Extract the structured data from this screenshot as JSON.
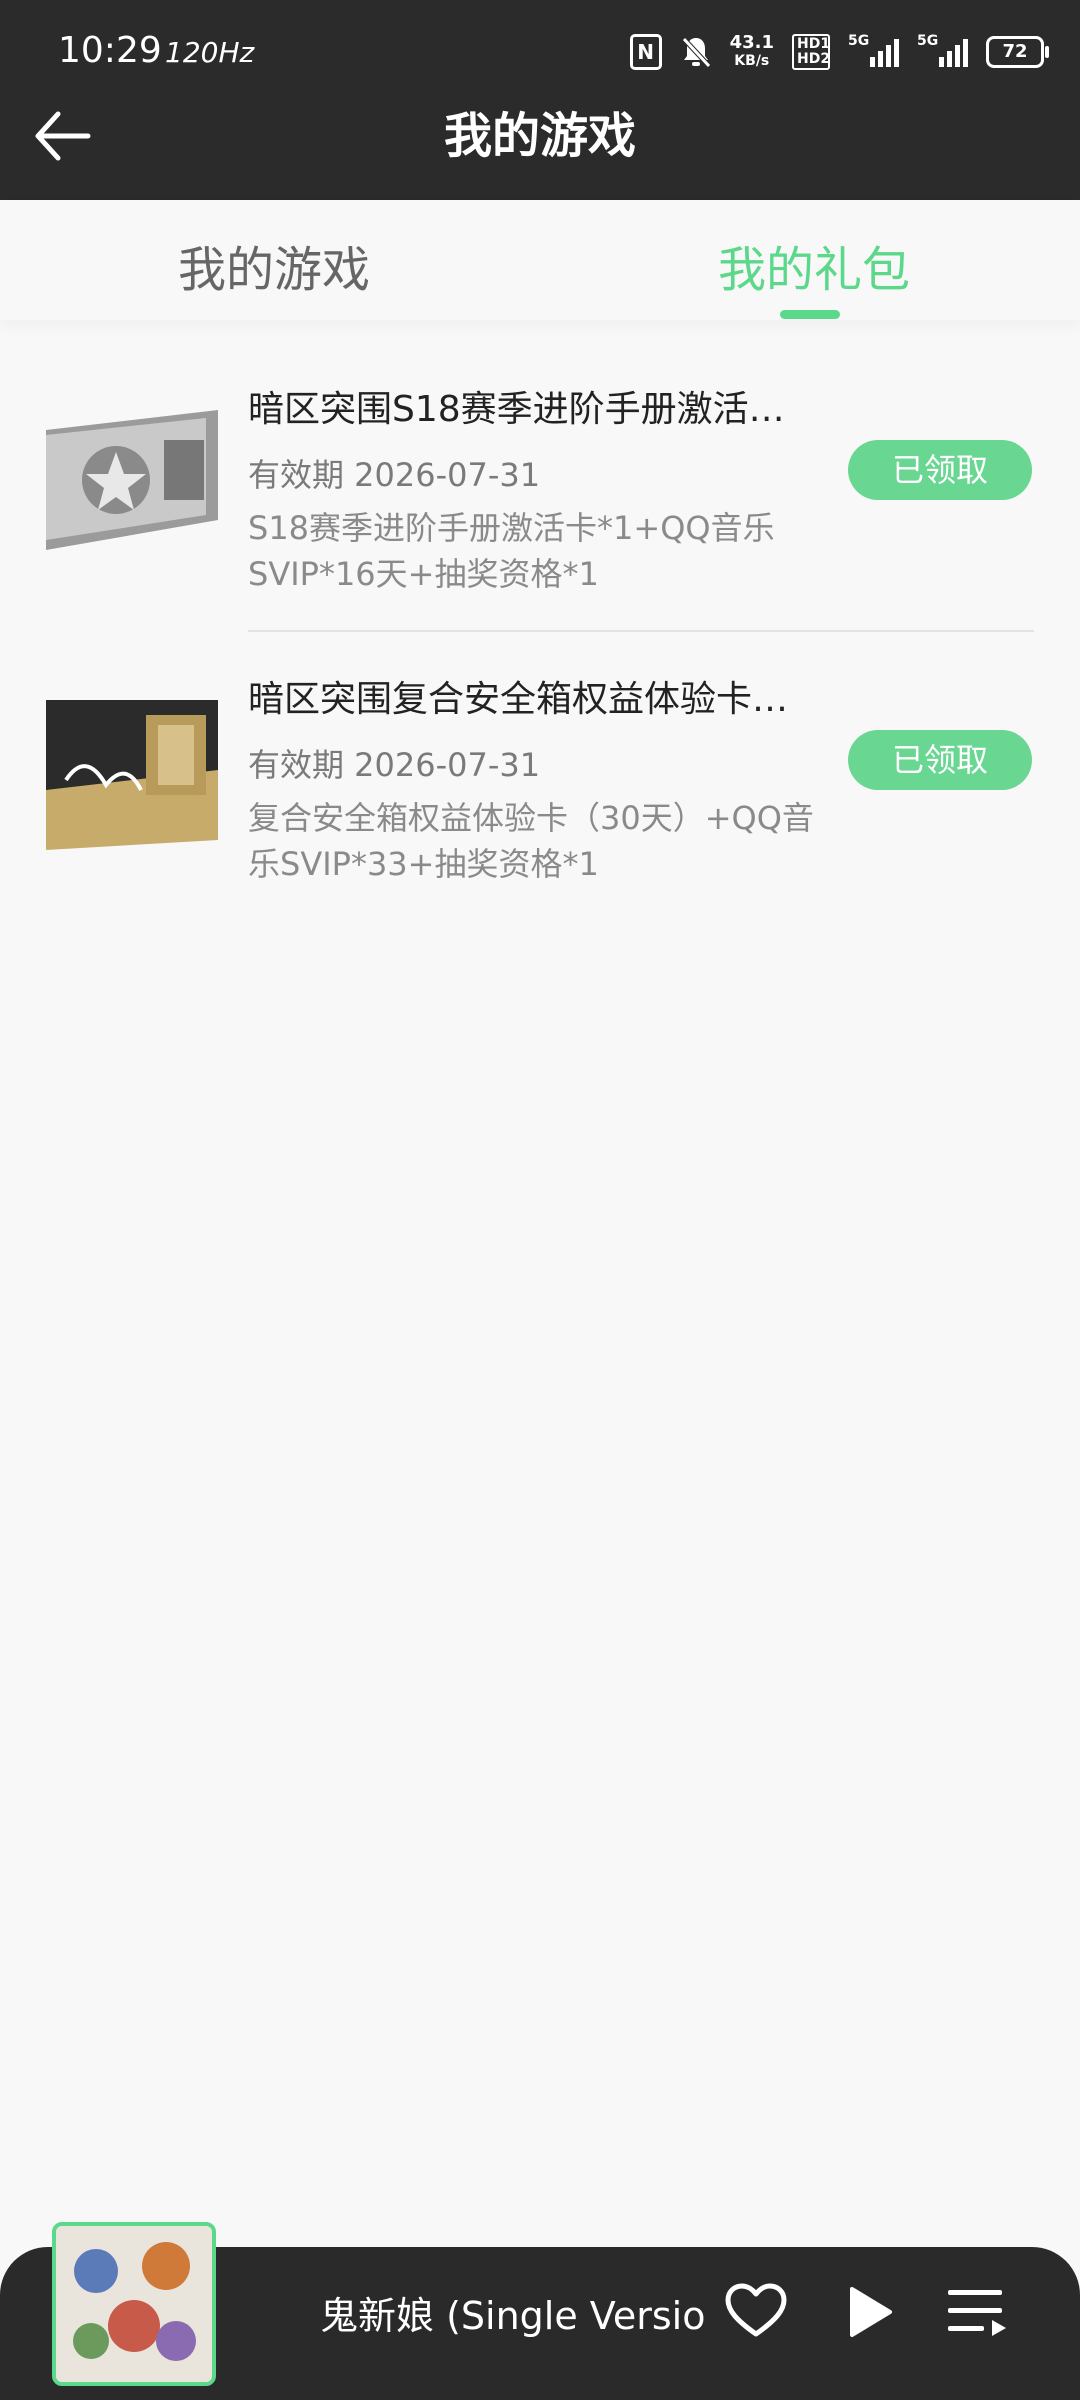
{
  "status_bar": {
    "time": "10:29",
    "refresh_rate": "120Hz",
    "nfc": "N",
    "net_speed_value": "43.1",
    "net_speed_unit": "KB/s",
    "hd_label": "HD1 HD2",
    "sim1": "5G",
    "sim2": "5G",
    "battery": "72"
  },
  "header": {
    "title": "我的游戏"
  },
  "tabs": [
    {
      "label": "我的游戏",
      "active": false
    },
    {
      "label": "我的礼包",
      "active": true
    }
  ],
  "gifts": [
    {
      "title": "暗区突围S18赛季进阶手册激活…",
      "validity": "有效期 2026-07-31",
      "description": "S18赛季进阶手册激活卡*1+QQ音乐SVIP*16天+抽奖资格*1",
      "status": "已领取"
    },
    {
      "title": "暗区突围复合安全箱权益体验卡…",
      "validity": "有效期 2026-07-31",
      "description": "复合安全箱权益体验卡（30天）+QQ音乐SVIP*33+抽奖资格*1",
      "status": "已领取"
    }
  ],
  "player": {
    "song": "鬼新娘 (Single Versio"
  },
  "colors": {
    "accent": "#5bd88a",
    "header_bg": "#2b2b2b"
  }
}
